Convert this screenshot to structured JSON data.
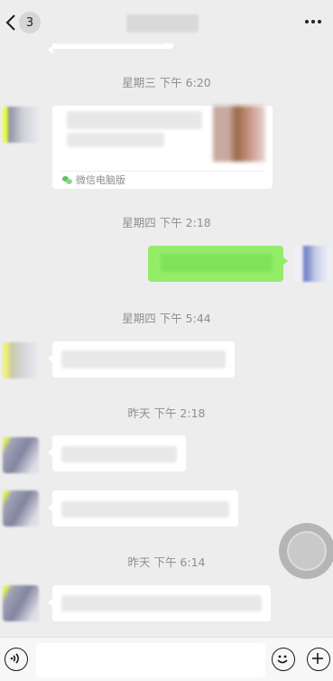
{
  "header": {
    "back_count": "3",
    "title": ""
  },
  "timestamps": {
    "t1": "星期三 下午 6:20",
    "t2": "星期四 下午 2:18",
    "t3": "星期四 下午 5:44",
    "t4": "昨天 下午 2:18",
    "t5": "昨天 下午 6:14"
  },
  "link_card": {
    "source": "微信电脑版"
  },
  "input": {
    "placeholder": ""
  },
  "icons": [
    "back-arrow-icon",
    "more-icon",
    "voice-icon",
    "emoji-icon",
    "plus-icon",
    "wechat-logo-icon"
  ],
  "colors": {
    "background": "#ededed",
    "incoming_bubble": "#ffffff",
    "outgoing_bubble": "#95ec69",
    "timestamp_text": "#8f8f8f"
  }
}
